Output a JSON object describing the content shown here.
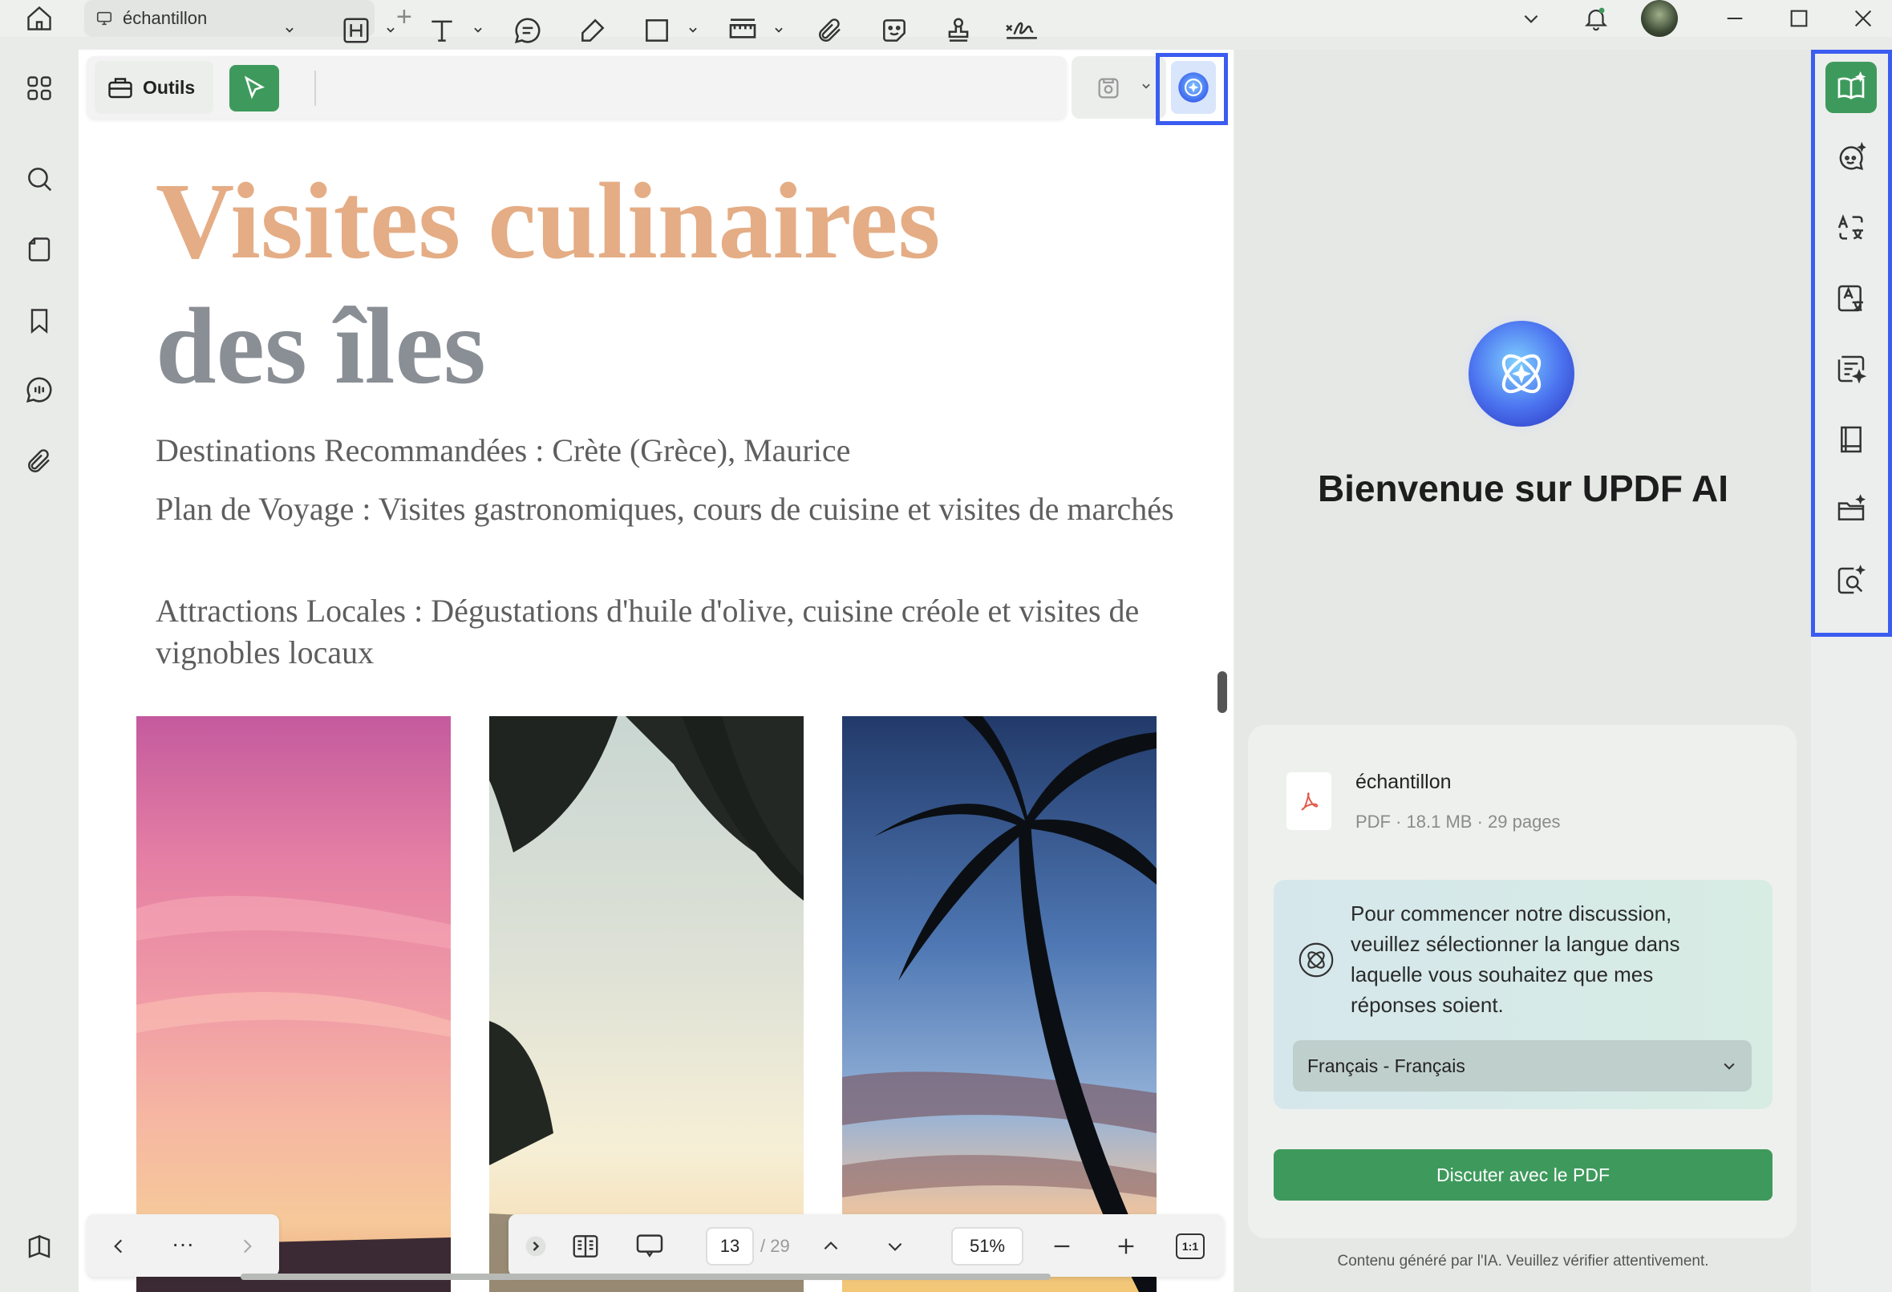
{
  "app": {
    "tab_title": "échantillon",
    "new_tab_symbol": "+"
  },
  "toolbar": {
    "tools_label": "Outils"
  },
  "document": {
    "title_line1": "Visites culinaires",
    "title_line2": "des îles",
    "paragraphs": [
      "Destinations Recommandées : Crète (Grèce), Maurice",
      "Plan de Voyage : Visites gastronomiques, cours de cuisine et visites de marchés",
      "Attractions Locales : Dégustations d'huile d'olive, cuisine créole et visites de vignobles locaux"
    ],
    "colors": {
      "title1": "#e5ad85",
      "title2": "#8a8e95"
    }
  },
  "page_nav": {
    "ellipsis": "···",
    "current_page": "13",
    "total_pages": "/ 29",
    "zoom": "51%",
    "fit_label": "1:1"
  },
  "ai_panel": {
    "welcome": "Bienvenue sur UPDF AI",
    "file_name": "échantillon",
    "file_meta": "PDF · 18.1 MB · 29 pages",
    "prompt": "Pour commencer notre discussion, veuillez sélectionner la langue dans laquelle vous souhaitez que mes réponses soient.",
    "language_selected": "Français - Français",
    "chat_button": "Discuter avec le PDF",
    "disclaimer": "Contenu généré par l'IA. Veuillez vérifier attentivement.",
    "accent": "#3e9a5c"
  },
  "highlight_color": "#3b5cf0"
}
